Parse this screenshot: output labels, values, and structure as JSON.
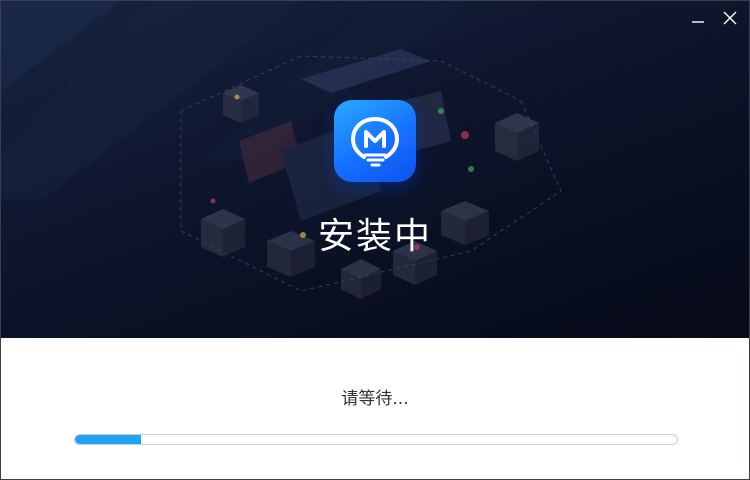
{
  "window": {
    "controls": {
      "minimize_icon": "minimize-icon",
      "close_icon": "close-icon"
    }
  },
  "hero": {
    "app_icon": "app-logo-icon",
    "title": "安装中"
  },
  "status": {
    "wait_text": "请等待..."
  },
  "progress": {
    "fraction": 0.11
  },
  "colors": {
    "hero_bg": "#0c1328",
    "accent": "#1fa3f3",
    "icon_gradient_start": "#2aa9ff",
    "icon_gradient_end": "#0d52f0"
  }
}
